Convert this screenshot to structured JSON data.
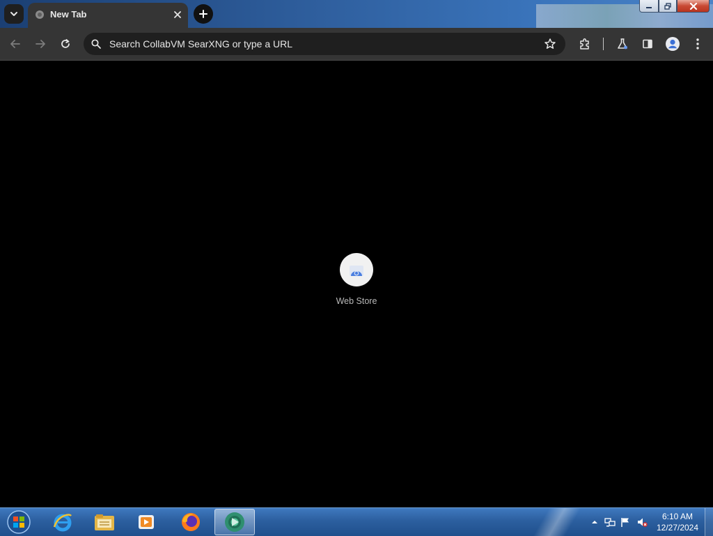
{
  "browser": {
    "tab": {
      "title": "New Tab"
    },
    "omnibox": {
      "placeholder": "Search CollabVM SearXNG or type a URL"
    },
    "toolbar_icons": [
      "back-arrow-icon",
      "forward-arrow-icon",
      "reload-icon",
      "bookmark-star-icon",
      "extensions-puzzle-icon",
      "labs-flask-icon",
      "side-panel-icon",
      "profile-icon",
      "menu-kebab-icon"
    ]
  },
  "new_tab_page": {
    "shortcuts": [
      {
        "label": "Web Store"
      }
    ]
  },
  "taskbar": {
    "pinned": [
      "start-orb-icon",
      "internet-explorer-icon",
      "file-explorer-icon",
      "media-player-icon",
      "firefox-icon",
      "chrome-app-icon"
    ],
    "clock": {
      "time": "6:10 AM",
      "date": "12/27/2024"
    }
  },
  "colors": {
    "tab_strip": "#2f5f9e",
    "toolbar": "#353535",
    "omnibox": "#1f1f1f",
    "page_background": "#000000",
    "taskbar": "#2c5f9f"
  }
}
